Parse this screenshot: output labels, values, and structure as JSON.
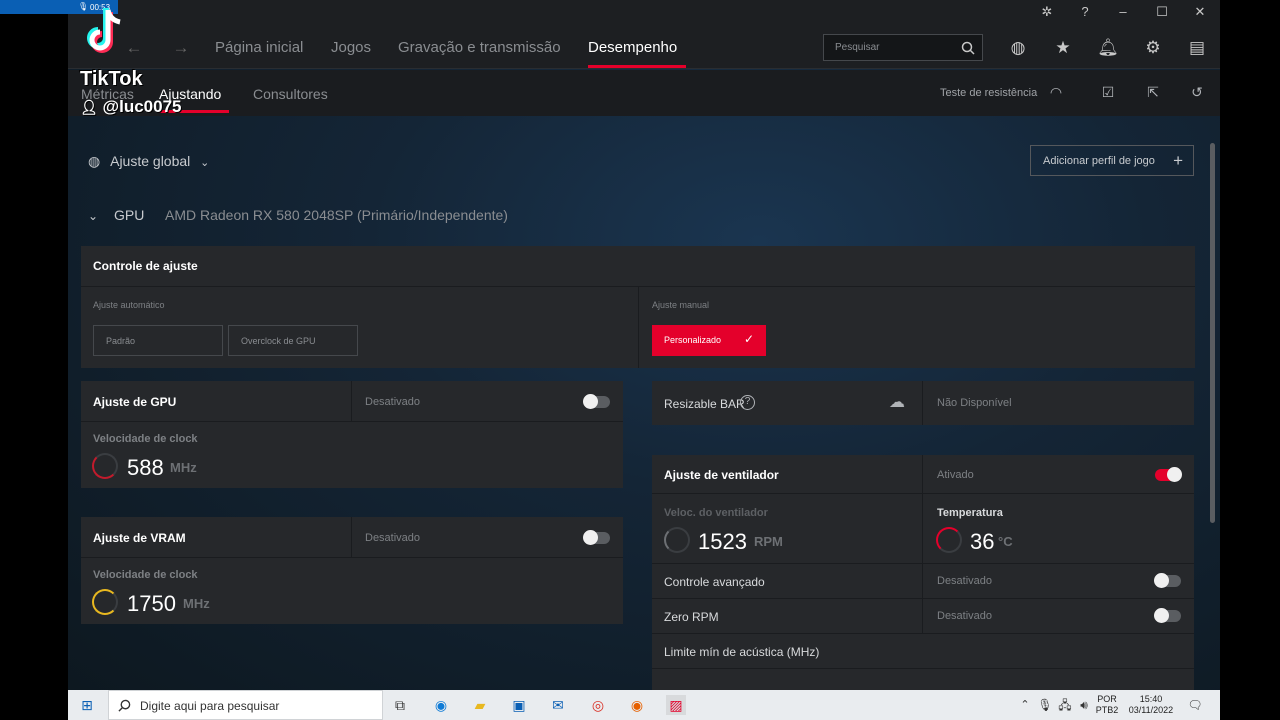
{
  "recording": {
    "time": "00:53"
  },
  "tiktok": {
    "brand": "TikTok",
    "user": "@luc0075"
  },
  "nav": {
    "items": [
      "Página inicial",
      "Jogos",
      "Gravação e transmissão",
      "Desempenho"
    ],
    "active": "Desempenho",
    "search_placeholder": "Pesquisar"
  },
  "subnav": {
    "items": [
      "Métricas",
      "Ajustando",
      "Consultores"
    ],
    "active": "Ajustando",
    "stress_test": "Teste de resistência"
  },
  "content": {
    "global_label": "Ajuste global",
    "add_profile": "Adicionar perfil de jogo",
    "gpu_label": "GPU",
    "gpu_name": "AMD Radeon RX 580 2048SP (Primário/Independente)",
    "tuning_control": {
      "title": "Controle de ajuste",
      "auto_label": "Ajuste automático",
      "auto_options": [
        "Padrão",
        "Overclock de GPU"
      ],
      "manual_label": "Ajuste manual",
      "manual_option": "Personalizado"
    },
    "gpu_tuning": {
      "title": "Ajuste de GPU",
      "state": "Desativado",
      "clock_label": "Velocidade de clock",
      "clock_value": "588",
      "clock_unit": "MHz"
    },
    "vram_tuning": {
      "title": "Ajuste de VRAM",
      "state": "Desativado",
      "clock_label": "Velocidade de clock",
      "clock_value": "1750",
      "clock_unit": "MHz"
    },
    "resizable_bar": {
      "title": "Resizable BAR",
      "state": "Não Disponível"
    },
    "fan_tuning": {
      "title": "Ajuste de ventilador",
      "state": "Ativado",
      "fan_speed_label": "Veloc. do ventilador",
      "fan_speed_value": "1523",
      "fan_speed_unit": "RPM",
      "temp_label": "Temperatura",
      "temp_value": "36",
      "temp_unit": "°C",
      "advanced_label": "Controle avançado",
      "advanced_state": "Desativado",
      "zero_rpm_label": "Zero RPM",
      "zero_rpm_state": "Desativado",
      "acoustic_label": "Limite mín de acústica (MHz)"
    }
  },
  "taskbar": {
    "search_placeholder": "Digite aqui para pesquisar",
    "lang1": "POR",
    "lang2": "PTB2",
    "time": "15:40",
    "date": "03/11/2022"
  },
  "colors": {
    "accent": "#e4002b",
    "panel": "#26282b",
    "gauge_yellow": "#e8b820"
  }
}
